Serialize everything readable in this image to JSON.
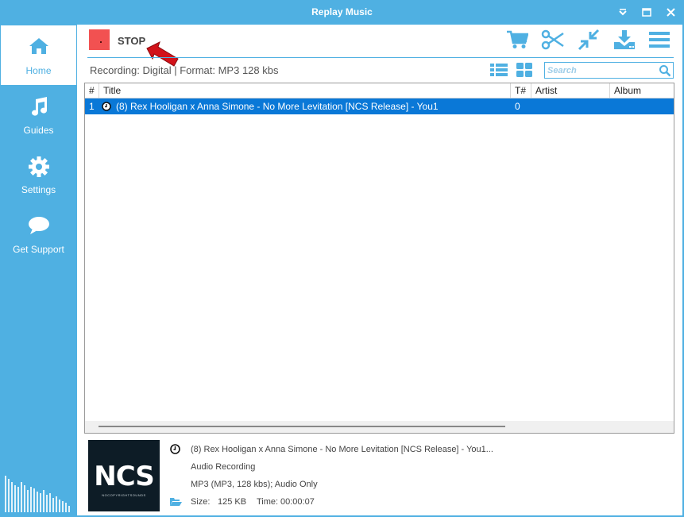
{
  "window": {
    "title": "Replay Music",
    "accent_color": "#4fb0e2"
  },
  "sidebar": {
    "items": [
      {
        "label": "Home",
        "icon": "home-icon",
        "active": true
      },
      {
        "label": "Guides",
        "icon": "music-note-icon",
        "active": false
      },
      {
        "label": "Settings",
        "icon": "gear-icon",
        "active": false
      },
      {
        "label": "Get Support",
        "icon": "speech-bubble-icon",
        "active": false
      }
    ]
  },
  "toolbar": {
    "stop_label": "STOP",
    "stop_color": "#f25151",
    "tools": [
      "cart-icon",
      "scissors-icon",
      "collapse-arrows-icon",
      "download-icon",
      "menu-icon"
    ]
  },
  "statusbar": {
    "recording_text": "Recording: Digital | Format: MP3 128 kbs",
    "view_buttons": [
      "list-view-icon",
      "grid-view-icon"
    ]
  },
  "search": {
    "placeholder": "Search",
    "value": ""
  },
  "table": {
    "columns": [
      "#",
      "Title",
      "T#",
      "Artist",
      "Album"
    ],
    "rows": [
      {
        "num": "1",
        "status_icon": "clock-icon",
        "title": "(8) Rex Hooligan x Anna Simone - No More Levitation [NCS Release] - You1",
        "track": "0",
        "artist": "",
        "album": "",
        "selected": true
      }
    ],
    "selected_color": "#0a78d7"
  },
  "details": {
    "album_art_text": "NCS",
    "album_art_subtext": "NOCOPYRIGHTSOUNDS",
    "title": "(8) Rex Hooligan x Anna Simone - No More Levitation [NCS Release] - You1...",
    "type": "Audio Recording",
    "format": "MP3 (MP3, 128 kbs); Audio Only",
    "size_label": "Size:",
    "size_value": "125 KB",
    "time_label": "Time:",
    "time_value": "00:00:07"
  }
}
